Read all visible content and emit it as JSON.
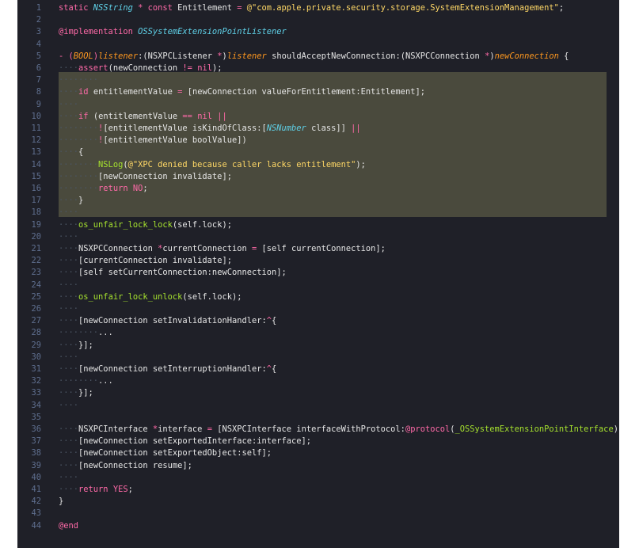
{
  "editor": {
    "language": "Objective-C",
    "colors": {
      "background": "#1f2028",
      "highlight": "#4a4a3d",
      "line_number": "#5f6f8f",
      "keyword": "#ff6aa8",
      "type": "#5fd1e8",
      "string": "#ffd866",
      "function": "#a6e22e",
      "parameter": "#fd971f",
      "text": "#e6e6e6"
    },
    "highlighted_lines": [
      6,
      17
    ],
    "lines": [
      {
        "n": "1",
        "tokens": [
          [
            "kw",
            "static "
          ],
          [
            "typ",
            "NSString"
          ],
          [
            "kw",
            " * const "
          ],
          [
            "plain",
            "Entitlement "
          ],
          [
            "kw",
            "= "
          ],
          [
            "str",
            "@\"com.apple.private.security.storage.SystemExtensionManagement\""
          ],
          [
            "plain",
            ";"
          ]
        ]
      },
      {
        "n": "2",
        "tokens": []
      },
      {
        "n": "3",
        "tokens": [
          [
            "kw",
            "@implementation "
          ],
          [
            "typ",
            "OSSystemExtensionPointListener"
          ]
        ]
      },
      {
        "n": "4",
        "tokens": []
      },
      {
        "n": "5",
        "tokens": [
          [
            "kw",
            "- ("
          ],
          [
            "par",
            "BOOL"
          ],
          [
            "kw",
            ")"
          ],
          [
            "par",
            "listener"
          ],
          [
            "plain",
            ":(NSXPCListener "
          ],
          [
            "kw",
            "*"
          ],
          [
            "plain",
            ")"
          ],
          [
            "par",
            "listener "
          ],
          [
            "plain",
            "shouldAcceptNewConnection:(NSXPCConnection "
          ],
          [
            "kw",
            "*"
          ],
          [
            "plain",
            ")"
          ],
          [
            "par",
            "newConnection"
          ],
          [
            "plain",
            " {"
          ]
        ]
      },
      {
        "n": "6",
        "tokens": [
          [
            "ws",
            "····"
          ],
          [
            "kw",
            "assert"
          ],
          [
            "plain",
            "(newConnection "
          ],
          [
            "kw",
            "!= nil"
          ],
          [
            "plain",
            ");"
          ]
        ]
      },
      {
        "n": "7",
        "tokens": [
          [
            "ws",
            "········"
          ]
        ]
      },
      {
        "n": "8",
        "tokens": [
          [
            "ws",
            "····"
          ],
          [
            "kw",
            "id "
          ],
          [
            "plain",
            "entitlementValue "
          ],
          [
            "kw",
            "= "
          ],
          [
            "plain",
            "[newConnection valueForEntitlement:Entitlement];"
          ]
        ]
      },
      {
        "n": "9",
        "tokens": [
          [
            "ws",
            "····"
          ]
        ]
      },
      {
        "n": "10",
        "tokens": [
          [
            "ws",
            "····"
          ],
          [
            "kw",
            "if "
          ],
          [
            "plain",
            "(entitlementValue "
          ],
          [
            "kw",
            "== nil ||"
          ]
        ]
      },
      {
        "n": "11",
        "tokens": [
          [
            "ws",
            "········"
          ],
          [
            "kw",
            "!"
          ],
          [
            "plain",
            "[entitlementValue isKindOfClass:["
          ],
          [
            "typ",
            "NSNumber"
          ],
          [
            "plain",
            " class]] "
          ],
          [
            "kw",
            "||"
          ]
        ]
      },
      {
        "n": "12",
        "tokens": [
          [
            "ws",
            "········"
          ],
          [
            "kw",
            "!"
          ],
          [
            "plain",
            "[entitlementValue boolValue])"
          ]
        ]
      },
      {
        "n": "13",
        "tokens": [
          [
            "ws",
            "····"
          ],
          [
            "plain",
            "{"
          ]
        ]
      },
      {
        "n": "14",
        "tokens": [
          [
            "ws",
            "········"
          ],
          [
            "fn",
            "NSLog"
          ],
          [
            "plain",
            "("
          ],
          [
            "str",
            "@\"XPC denied because caller lacks entitlement\""
          ],
          [
            "plain",
            ");"
          ]
        ]
      },
      {
        "n": "15",
        "tokens": [
          [
            "ws",
            "········"
          ],
          [
            "plain",
            "[newConnection invalidate];"
          ]
        ]
      },
      {
        "n": "16",
        "tokens": [
          [
            "ws",
            "········"
          ],
          [
            "kw",
            "return NO"
          ],
          [
            "plain",
            ";"
          ]
        ]
      },
      {
        "n": "17",
        "tokens": [
          [
            "ws",
            "····"
          ],
          [
            "plain",
            "}"
          ]
        ]
      },
      {
        "n": "18",
        "tokens": [
          [
            "ws",
            "····"
          ]
        ]
      },
      {
        "n": "19",
        "tokens": [
          [
            "ws",
            "····"
          ],
          [
            "fn",
            "os_unfair_lock_lock"
          ],
          [
            "plain",
            "(self.lock);"
          ]
        ]
      },
      {
        "n": "20",
        "tokens": [
          [
            "ws",
            "····"
          ]
        ]
      },
      {
        "n": "21",
        "tokens": [
          [
            "ws",
            "····"
          ],
          [
            "plain",
            "NSXPCConnection "
          ],
          [
            "kw",
            "*"
          ],
          [
            "plain",
            "currentConnection "
          ],
          [
            "kw",
            "= "
          ],
          [
            "plain",
            "[self currentConnection];"
          ]
        ]
      },
      {
        "n": "22",
        "tokens": [
          [
            "ws",
            "····"
          ],
          [
            "plain",
            "[currentConnection invalidate];"
          ]
        ]
      },
      {
        "n": "23",
        "tokens": [
          [
            "ws",
            "····"
          ],
          [
            "plain",
            "[self setCurrentConnection:newConnection];"
          ]
        ]
      },
      {
        "n": "24",
        "tokens": [
          [
            "ws",
            "····"
          ]
        ]
      },
      {
        "n": "25",
        "tokens": [
          [
            "ws",
            "····"
          ],
          [
            "fn",
            "os_unfair_lock_unlock"
          ],
          [
            "plain",
            "(self.lock);"
          ]
        ]
      },
      {
        "n": "26",
        "tokens": [
          [
            "ws",
            "····"
          ]
        ]
      },
      {
        "n": "27",
        "tokens": [
          [
            "ws",
            "····"
          ],
          [
            "plain",
            "[newConnection setInvalidationHandler:"
          ],
          [
            "kw",
            "^"
          ],
          [
            "plain",
            "{"
          ]
        ]
      },
      {
        "n": "28",
        "tokens": [
          [
            "ws",
            "········"
          ],
          [
            "plain",
            "..."
          ]
        ]
      },
      {
        "n": "29",
        "tokens": [
          [
            "ws",
            "····"
          ],
          [
            "plain",
            "}];"
          ]
        ]
      },
      {
        "n": "30",
        "tokens": [
          [
            "ws",
            "····"
          ]
        ]
      },
      {
        "n": "31",
        "tokens": [
          [
            "ws",
            "····"
          ],
          [
            "plain",
            "[newConnection setInterruptionHandler:"
          ],
          [
            "kw",
            "^"
          ],
          [
            "plain",
            "{"
          ]
        ]
      },
      {
        "n": "32",
        "tokens": [
          [
            "ws",
            "········"
          ],
          [
            "plain",
            "..."
          ]
        ]
      },
      {
        "n": "33",
        "tokens": [
          [
            "ws",
            "····"
          ],
          [
            "plain",
            "}];"
          ]
        ]
      },
      {
        "n": "34",
        "tokens": [
          [
            "ws",
            "····"
          ]
        ]
      },
      {
        "n": "35",
        "tokens": []
      },
      {
        "n": "36",
        "tokens": [
          [
            "ws",
            "····"
          ],
          [
            "plain",
            "NSXPCInterface "
          ],
          [
            "kw",
            "*"
          ],
          [
            "plain",
            "interface "
          ],
          [
            "kw",
            "= "
          ],
          [
            "plain",
            "[NSXPCInterface interfaceWithProtocol:"
          ],
          [
            "kw",
            "@protocol"
          ],
          [
            "plain",
            "("
          ],
          [
            "fn",
            "_OSSystemExtensionPointInterface"
          ],
          [
            "plain",
            ")]"
          ]
        ]
      },
      {
        "n": "37",
        "tokens": [
          [
            "ws",
            "····"
          ],
          [
            "plain",
            "[newConnection setExportedInterface:interface];"
          ]
        ]
      },
      {
        "n": "38",
        "tokens": [
          [
            "ws",
            "····"
          ],
          [
            "plain",
            "[newConnection setExportedObject:self];"
          ]
        ]
      },
      {
        "n": "39",
        "tokens": [
          [
            "ws",
            "····"
          ],
          [
            "plain",
            "[newConnection resume];"
          ]
        ]
      },
      {
        "n": "40",
        "tokens": [
          [
            "ws",
            "····"
          ]
        ]
      },
      {
        "n": "41",
        "tokens": [
          [
            "ws",
            "····"
          ],
          [
            "kw",
            "return YES"
          ],
          [
            "plain",
            ";"
          ]
        ]
      },
      {
        "n": "42",
        "tokens": [
          [
            "plain",
            "}"
          ]
        ]
      },
      {
        "n": "43",
        "tokens": []
      },
      {
        "n": "44",
        "tokens": [
          [
            "kw",
            "@end"
          ]
        ]
      }
    ]
  }
}
